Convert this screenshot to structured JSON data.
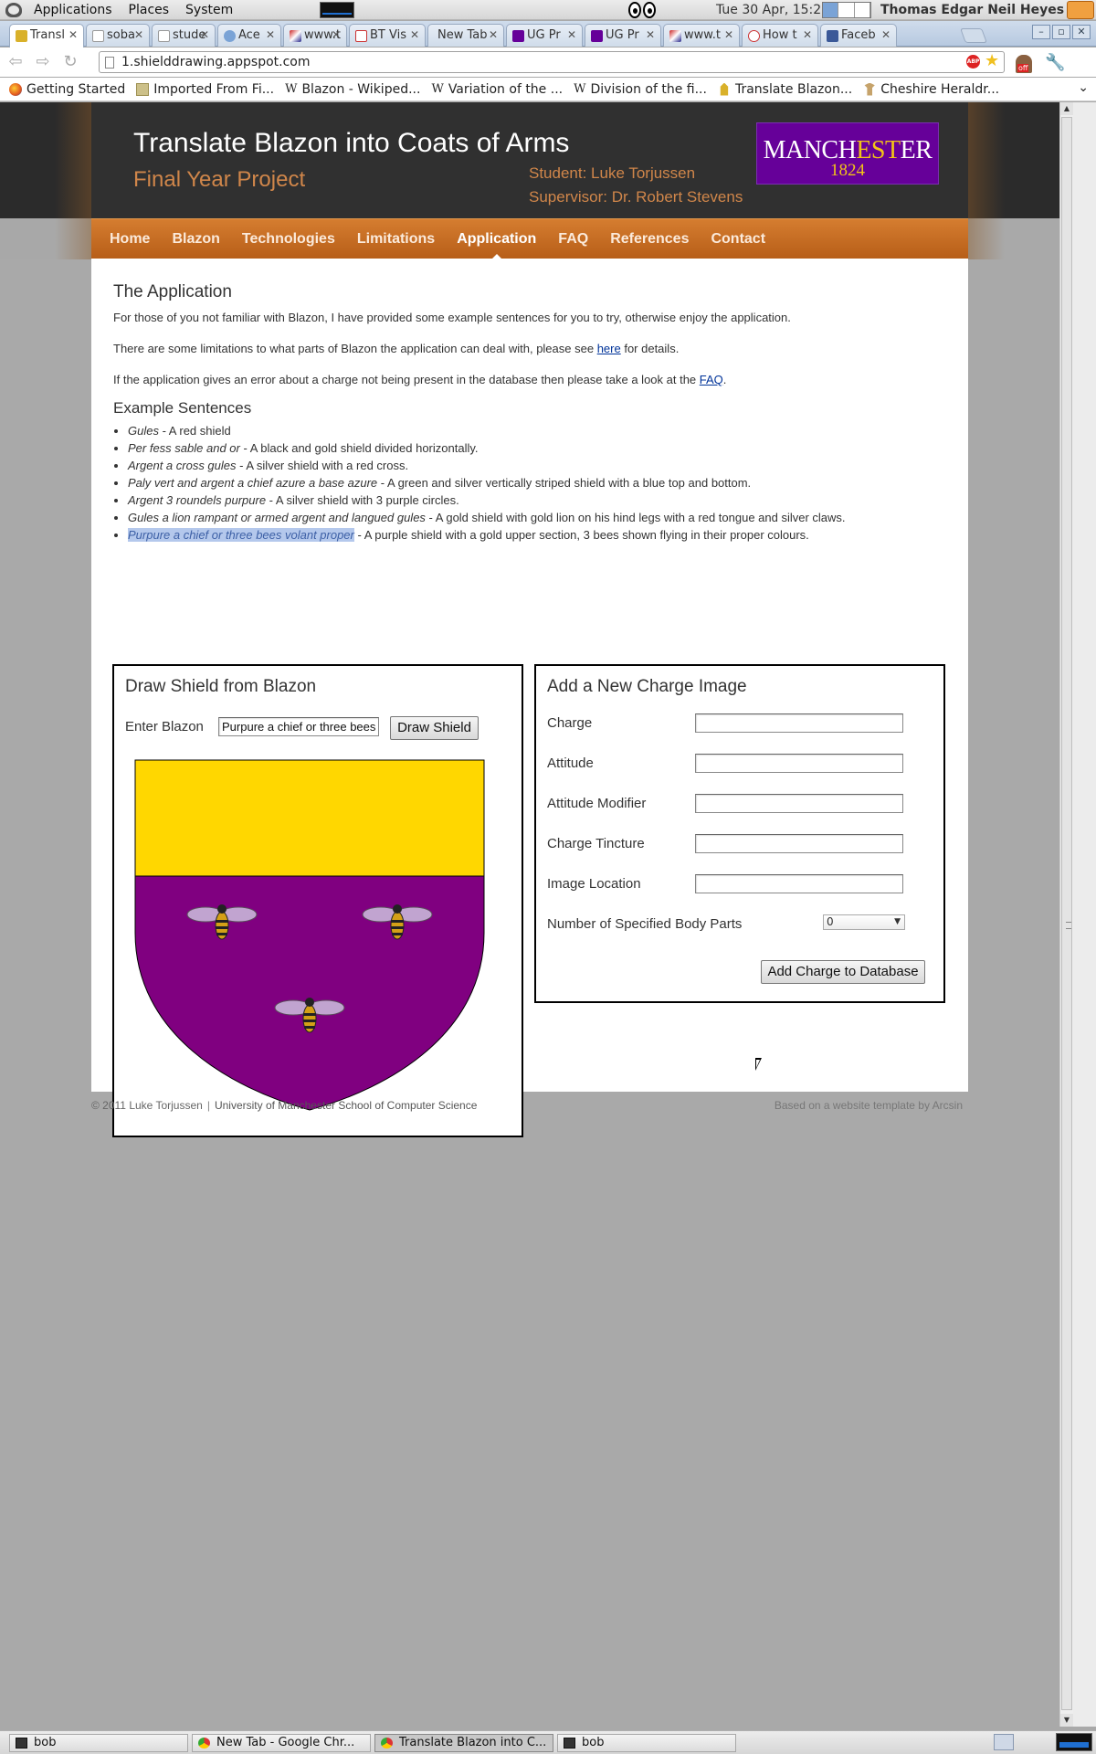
{
  "system_panel": {
    "menus": [
      "Applications",
      "Places",
      "System"
    ],
    "clock": "Tue 30 Apr, 15:22",
    "username": "Thomas Edgar Neil Heyes"
  },
  "browser": {
    "tabs": [
      {
        "label": "Transl",
        "icon": "lion-favicon-icon",
        "active": true
      },
      {
        "label": "soba",
        "icon": "page-favicon-icon"
      },
      {
        "label": "stude",
        "icon": "page-favicon-icon"
      },
      {
        "label": "Ace",
        "icon": "cloud-favicon-icon"
      },
      {
        "label": "www.t",
        "icon": "flag-favicon-icon"
      },
      {
        "label": "BT Vis",
        "icon": "gmail-favicon-icon"
      },
      {
        "label": "New Tab",
        "icon": ""
      },
      {
        "label": "UG Pr",
        "icon": "manchester-favicon-icon"
      },
      {
        "label": "UG Pr",
        "icon": "manchester-favicon-icon"
      },
      {
        "label": "www.t",
        "icon": "flag-favicon-icon"
      },
      {
        "label": "How t",
        "icon": "face-favicon-icon"
      },
      {
        "label": "Faceb",
        "icon": "facebook-favicon-icon"
      }
    ],
    "url": "1.shielddrawing.appspot.com",
    "bookmarks": [
      {
        "label": "Getting Started",
        "icon": "firefox-icon"
      },
      {
        "label": "Imported From Fi...",
        "icon": "folder-icon"
      },
      {
        "label": "Blazon - Wikiped...",
        "icon": "wikipedia-icon"
      },
      {
        "label": "Variation of the ...",
        "icon": "wikipedia-icon"
      },
      {
        "label": "Division of the fi...",
        "icon": "wikipedia-icon"
      },
      {
        "label": "Translate Blazon...",
        "icon": "lion-icon"
      },
      {
        "label": "Cheshire Heraldr...",
        "icon": "chess-icon"
      }
    ]
  },
  "site": {
    "title": "Translate Blazon into Coats of Arms",
    "subtitle": "Final Year Project",
    "student": "Student: Luke Torjussen",
    "supervisor": "Supervisor: Dr. Robert Stevens",
    "logo": {
      "line1_a": "MANCH",
      "line1_b": "EST",
      "line1_c": "ER",
      "line2": "1824"
    },
    "nav": [
      "Home",
      "Blazon",
      "Technologies",
      "Limitations",
      "Application",
      "FAQ",
      "References",
      "Contact"
    ],
    "nav_active": "Application"
  },
  "content": {
    "heading": "The Application",
    "intro": "For those of you not familiar with Blazon, I have provided some example sentences for you to try, otherwise enjoy the application.",
    "limits_before": "There are some limitations to what parts of Blazon the application can deal with, please see ",
    "limits_link": "here",
    "limits_after": " for details.",
    "faq_before": "If the application gives an error about a charge not being present in the database then please take a look at the ",
    "faq_link": "FAQ",
    "faq_after": ".",
    "examples_heading": "Example Sentences",
    "examples": [
      {
        "blazon": "Gules",
        "desc": " - A red shield"
      },
      {
        "blazon": "Per fess sable and or",
        "desc": " - A black and gold shield divided horizontally."
      },
      {
        "blazon": "Argent a cross gules",
        "desc": " - A silver shield with a red cross."
      },
      {
        "blazon": "Paly vert and argent a chief azure a base azure",
        "desc": " - A green and silver vertically striped shield with a blue top and bottom."
      },
      {
        "blazon": "Argent 3 roundels purpure",
        "desc": " - A silver shield with 3 purple circles."
      },
      {
        "blazon": "Gules a lion rampant or armed argent and langued gules",
        "desc": " - A gold shield with gold lion on his hind legs with a red tongue and silver claws."
      },
      {
        "blazon": "Purpure a chief or three bees volant proper",
        "desc": " - A purple shield with a gold upper section, 3 bees shown flying in their proper colours."
      }
    ],
    "selected_example": 6
  },
  "draw_panel": {
    "title": "Draw Shield from Blazon",
    "label": "Enter Blazon",
    "input_value": "Purpure a chief or three bees",
    "button": "Draw Shield",
    "shield": {
      "chief_color": "#FFD700",
      "field_color": "#800080",
      "charge": "bee-icon",
      "charge_count": 3
    }
  },
  "charge_panel": {
    "title": "Add a New Charge Image",
    "fields": [
      {
        "label": "Charge",
        "value": ""
      },
      {
        "label": "Attitude",
        "value": ""
      },
      {
        "label": "Attitude Modifier",
        "value": ""
      },
      {
        "label": "Charge Tincture",
        "value": ""
      },
      {
        "label": "Image Location",
        "value": ""
      }
    ],
    "body_parts_label": "Number of Specified Body Parts",
    "body_parts_value": "0",
    "button": "Add Charge to Database"
  },
  "footer": {
    "copyright": "© 2011 Luke Torjussen",
    "separator": "|",
    "university": "University of Manchester School of Computer Science",
    "credit": "Based on a website template by Arcsin"
  },
  "taskbar": [
    {
      "label": "bob",
      "icon": "terminal-icon"
    },
    {
      "label": "New Tab - Google Chr...",
      "icon": "chrome-icon"
    },
    {
      "label": "Translate Blazon into C...",
      "icon": "chrome-icon",
      "active": true
    },
    {
      "label": "bob",
      "icon": "terminal-icon"
    }
  ],
  "colors": {
    "header_bg": "#303030",
    "accent_orange": "#c96c22",
    "title_orange": "#d0864a",
    "manchester_purple": "#660099"
  }
}
